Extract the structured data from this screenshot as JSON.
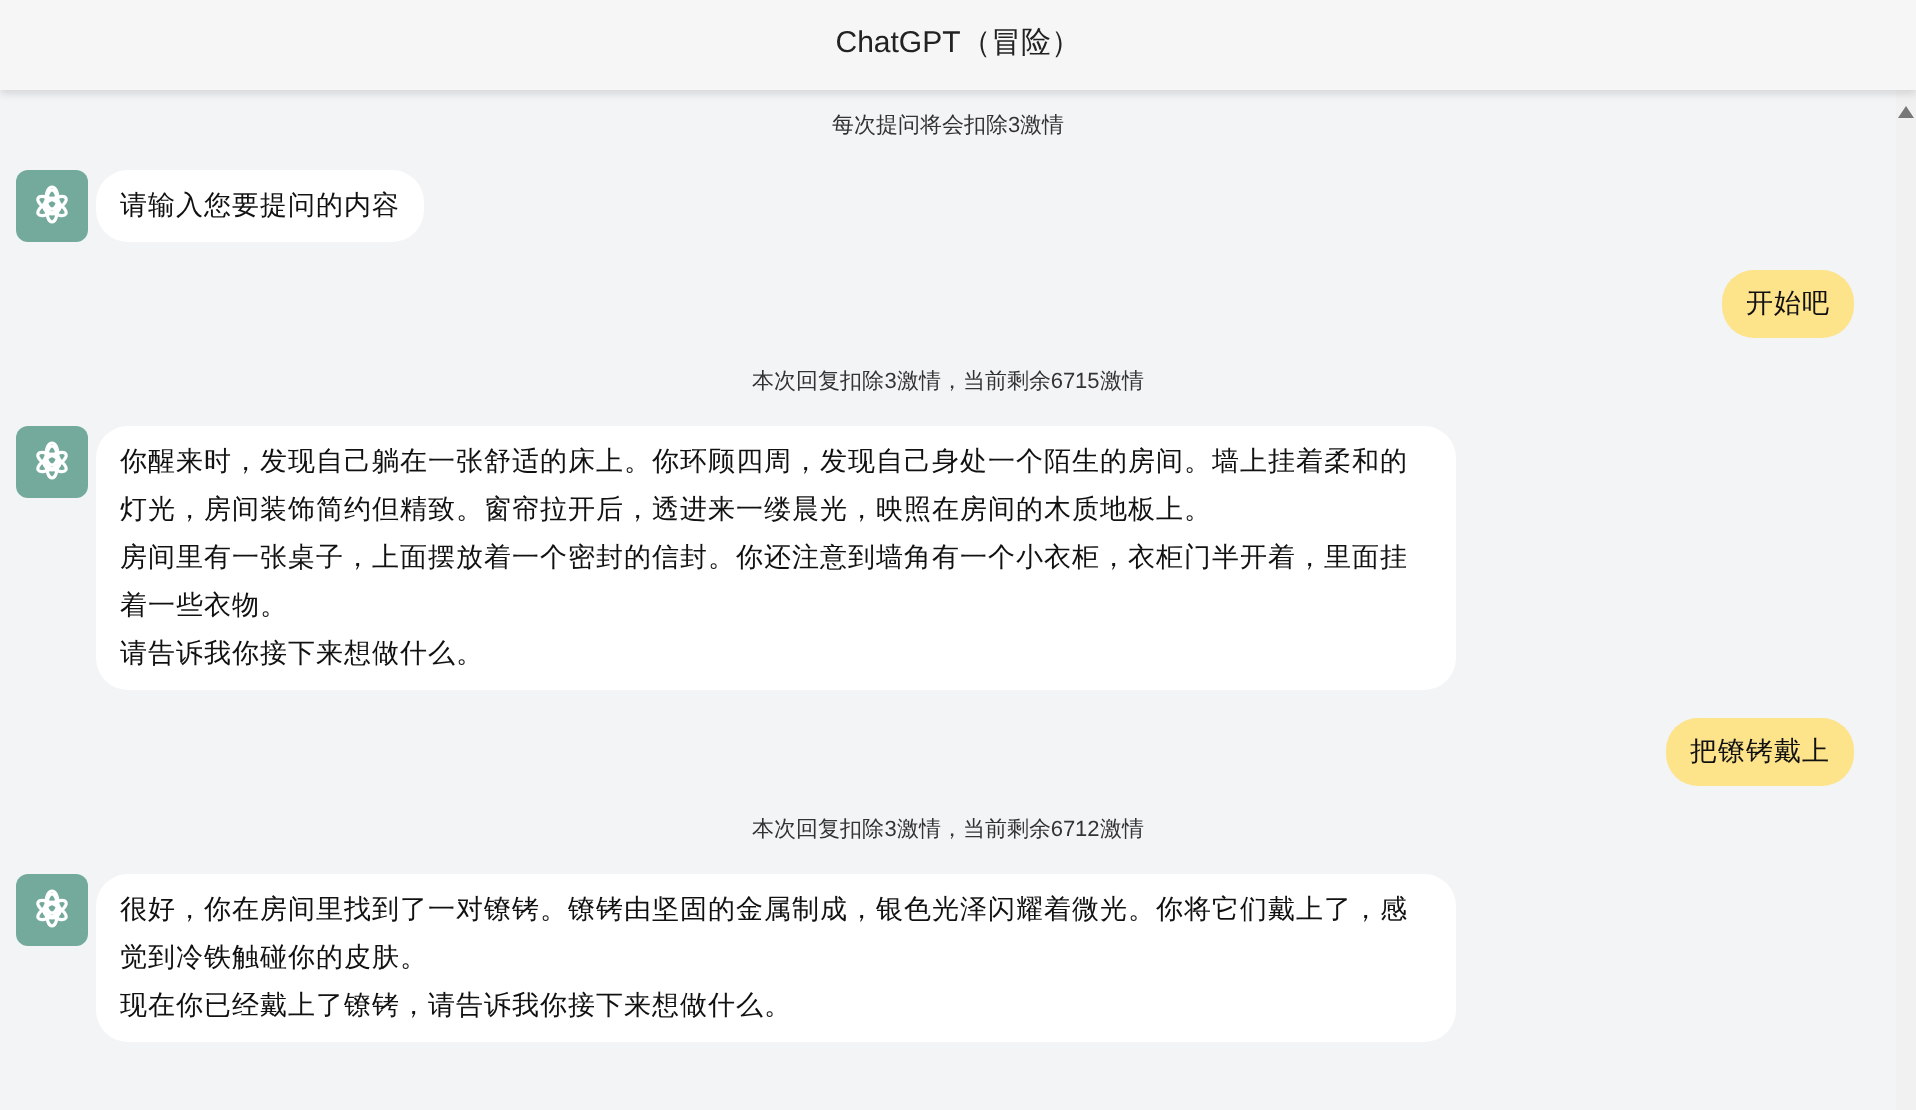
{
  "header": {
    "title": "ChatGPT（冒险）"
  },
  "messages": [
    {
      "kind": "notice",
      "text": "每次提问将会扣除3激情"
    },
    {
      "kind": "bot",
      "paragraphs": [
        "请输入您要提问的内容"
      ]
    },
    {
      "kind": "user",
      "text": "开始吧"
    },
    {
      "kind": "notice",
      "text": "本次回复扣除3激情，当前剩余6715激情"
    },
    {
      "kind": "bot",
      "paragraphs": [
        "你醒来时，发现自己躺在一张舒适的床上。你环顾四周，发现自己身处一个陌生的房间。墙上挂着柔和的灯光，房间装饰简约但精致。窗帘拉开后，透进来一缕晨光，映照在房间的木质地板上。",
        "房间里有一张桌子，上面摆放着一个密封的信封。你还注意到墙角有一个小衣柜，衣柜门半开着，里面挂着一些衣物。",
        "请告诉我你接下来想做什么。"
      ]
    },
    {
      "kind": "user",
      "text": "把镣铐戴上"
    },
    {
      "kind": "notice",
      "text": "本次回复扣除3激情，当前剩余6712激情"
    },
    {
      "kind": "bot",
      "paragraphs": [
        "很好，你在房间里找到了一对镣铐。镣铐由坚固的金属制成，银色光泽闪耀着微光。你将它们戴上了，感觉到冷铁触碰你的皮肤。",
        "现在你已经戴上了镣铐，请告诉我你接下来想做什么。"
      ]
    }
  ]
}
